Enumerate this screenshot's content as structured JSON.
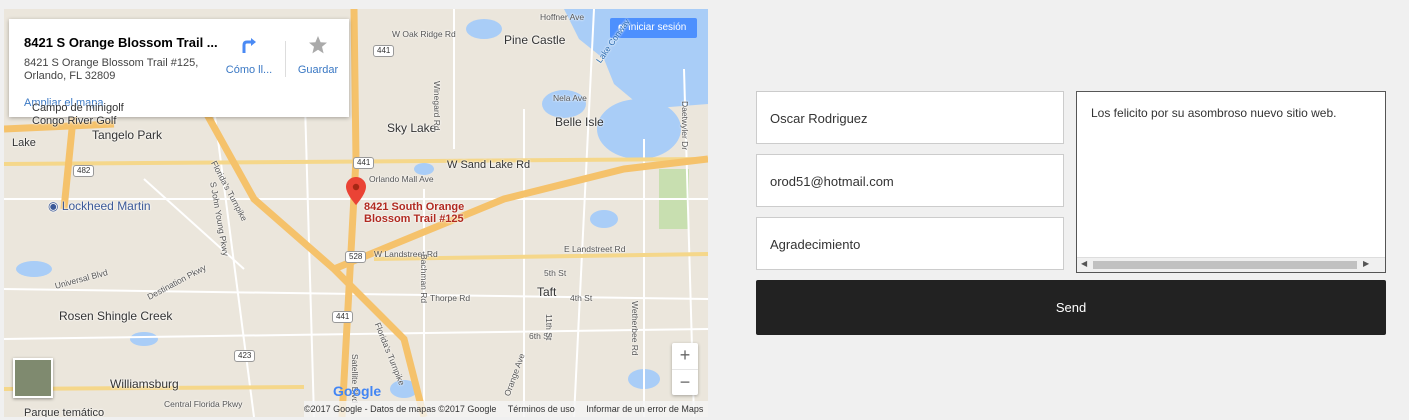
{
  "map": {
    "infobox": {
      "title": "8421 S Orange Blossom Trail ...",
      "address_line1": "8421 S Orange Blossom Trail #125,",
      "address_line2": "Orlando, FL 32809",
      "expand_link": "Ampliar el mapa",
      "directions_label": "Cómo ll...",
      "save_label": "Guardar"
    },
    "signin": {
      "icon": "g",
      "label": "Iniciar sesión"
    },
    "pin_label_line1": "8421 South Orange",
    "pin_label_line2": "Blossom Trail #125",
    "labels": {
      "pine_castle": "Pine Castle",
      "sky_lake": "Sky Lake",
      "belle_isle": "Belle Isle",
      "tangelo_park": "Tangelo Park",
      "lockheed": "Lockheed Martin",
      "rosen": "Rosen Shingle Creek",
      "taft": "Taft",
      "williamsburg": "Williamsburg",
      "campo": "Campo de minigolf",
      "congo": "Congo River Golf",
      "lake": "Lake",
      "parque": "Parque temático",
      "w_sand_lake": "W Sand Lake Rd",
      "w_landstreet": "W Landstreet Rd",
      "e_landstreet": "E Landstreet Rd",
      "florida_tpk": "Florida's Turnpike",
      "florida_tpk2": "Florida's Turnpike",
      "orlando_mall": "Orlando Mall Ave",
      "w_oak_ridge": "W Oak Ridge Rd",
      "hoffner": "Hoffner Ave",
      "nela": "Nela Ave",
      "winegard": "Winegard Rd",
      "universal": "Universal Blvd",
      "destination": "Destination Pkwy",
      "john_young": "S John Young Pkwy",
      "central_florida": "Central Florida Pkwy",
      "thorpe": "Thorpe Rd",
      "bachman": "Bachman Rd",
      "satellite": "Satellite Blvd",
      "orange_ave": "Orange Ave",
      "fourth_st": "4th St",
      "fifth_st": "5th St",
      "sixth_st": "6th St",
      "eleventh_st": "11th St",
      "wetherbee": "Wetherbee Rd",
      "daetwyler": "Daetwyler Dr",
      "lake_conway": "Lake Conway"
    },
    "shields": {
      "s441a": "441",
      "s441b": "441",
      "s441c": "441",
      "s528": "528",
      "s482": "482",
      "s423": "423"
    },
    "zoom_in": "+",
    "zoom_out": "−",
    "google_logo": "Google",
    "footer": {
      "copyright": "©2017 Google - Datos de mapas ©2017 Google",
      "terms": "Términos de uso",
      "report": "Informar de un error de Maps"
    }
  },
  "form": {
    "name_value": "Oscar Rodriguez",
    "email_value": "orod51@hotmail.com",
    "subject_value": "Agradecimiento",
    "message_value": "Los felicito por su asombroso nuevo sitio web.",
    "send_label": "Send"
  },
  "colors": {
    "send_bg": "#222222",
    "link": "#3a78c4",
    "water": "#a9cdf7",
    "highway": "#f5c26b"
  }
}
